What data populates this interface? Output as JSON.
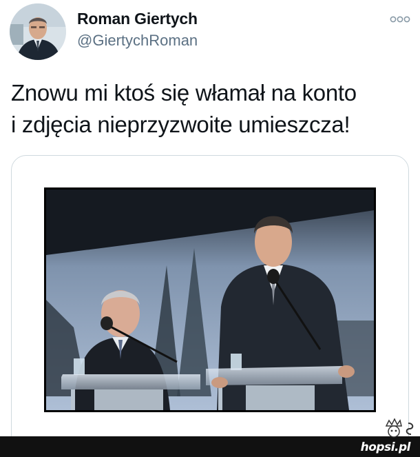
{
  "tweet": {
    "author": {
      "display_name": "Roman Giertych",
      "handle": "@GiertychRoman",
      "avatar_icon": "profile-photo"
    },
    "menu_icon": "more-horizontal-icon",
    "text_lines": [
      "Znowu mi ktoś się włamał na konto",
      "i zdjęcia nieprzyzwoite umieszcza!"
    ],
    "media": {
      "type": "photo",
      "description_icon": "photo-two-men-at-podiums"
    }
  },
  "watermark": {
    "site": "hopsi.pl",
    "text": "hopsi.pl"
  },
  "colors": {
    "text_primary": "#0f1419",
    "text_secondary": "#5b7083",
    "card_border": "#cfd9de",
    "watermark_bg": "#111111"
  }
}
